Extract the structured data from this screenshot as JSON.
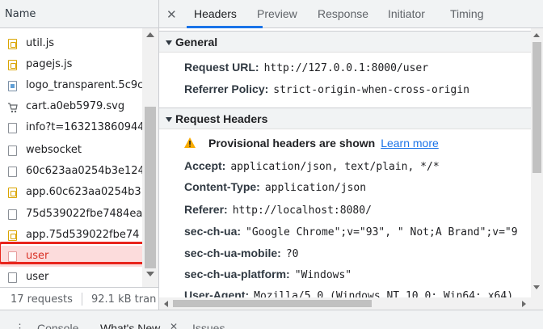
{
  "file_list": {
    "header": "Name",
    "items": [
      {
        "name": "util.js",
        "icon": "js-file-icon"
      },
      {
        "name": "pagejs.js",
        "icon": "js-file-icon"
      },
      {
        "name": "logo_transparent.5c9c",
        "icon": "image-file-icon"
      },
      {
        "name": "cart.a0eb5979.svg",
        "icon": "svg-file-icon"
      },
      {
        "name": "info?t=163213860944",
        "icon": "document-file-icon"
      },
      {
        "name": "websocket",
        "icon": "document-file-icon"
      },
      {
        "name": "60c623aa0254b3e124",
        "icon": "document-file-icon"
      },
      {
        "name": "app.60c623aa0254b3",
        "icon": "js-file-icon"
      },
      {
        "name": "75d539022fbe7484ea",
        "icon": "document-file-icon"
      },
      {
        "name": "app.75d539022fbe74",
        "icon": "js-file-icon"
      },
      {
        "name": "user",
        "icon": "document-file-icon",
        "selected": true
      },
      {
        "name": "user",
        "icon": "document-file-icon"
      }
    ],
    "status": {
      "requests": "17 requests",
      "transferred": "92.1 kB tran"
    }
  },
  "detail_tabs": {
    "close_symbol": "✕",
    "items": [
      "Headers",
      "Preview",
      "Response",
      "Initiator",
      "Timing"
    ],
    "active": "Headers"
  },
  "general": {
    "title": "General",
    "request_url_label": "Request URL:",
    "request_url": "http://127.0.0.1:8000/user",
    "referrer_policy_label": "Referrer Policy:",
    "referrer_policy": "strict-origin-when-cross-origin"
  },
  "request_headers": {
    "title": "Request Headers",
    "provisional_text": "Provisional headers are shown",
    "learn_more": "Learn more",
    "rows": [
      {
        "key": "Accept:",
        "value": "application/json, text/plain, */*"
      },
      {
        "key": "Content-Type:",
        "value": "application/json"
      },
      {
        "key": "Referer:",
        "value": "http://localhost:8080/"
      },
      {
        "key": "sec-ch-ua:",
        "value": "\"Google Chrome\";v=\"93\", \" Not;A Brand\";v=\"9"
      },
      {
        "key": "sec-ch-ua-mobile:",
        "value": "?0"
      },
      {
        "key": "sec-ch-ua-platform:",
        "value": "\"Windows\""
      },
      {
        "key": "User-Agent:",
        "value": "Mozilla/5.0 (Windows NT 10.0; Win64; x64)"
      }
    ]
  },
  "drawer": {
    "menu_symbol": "⋮",
    "tabs": [
      "Console",
      "What's New",
      "Issues"
    ],
    "active": "What's New",
    "close_symbol": "✕"
  },
  "colors": {
    "accent": "#1a73e8",
    "selected_row_bg": "#fcdcdc",
    "selected_row_text": "#d93025",
    "highlight_box": "#e8251c",
    "warning": "#f9ab00"
  }
}
